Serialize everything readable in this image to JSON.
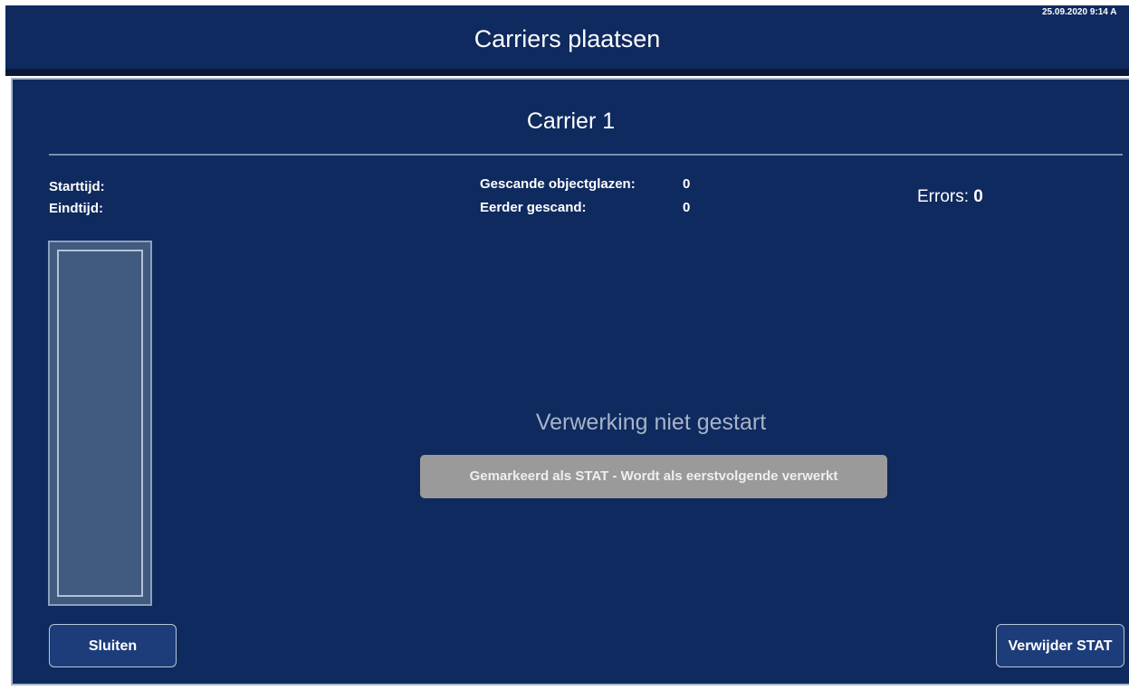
{
  "header": {
    "title": "Carriers plaatsen",
    "datetime": "25.09.2020 9:14 A"
  },
  "panel": {
    "title": "Carrier 1",
    "starttijd_label": "Starttijd:",
    "eindtijd_label": "Eindtijd:",
    "gescande_label": "Gescande objectglazen:",
    "gescande_value": "0",
    "eerder_label": "Eerder gescand:",
    "eerder_value": "0",
    "errors_label": "Errors:",
    "errors_value": "0",
    "status_text": "Verwerking niet gestart",
    "stat_banner": "Gemarkeerd als STAT - Wordt als eerstvolgende verwerkt"
  },
  "buttons": {
    "close_label": "Sluiten",
    "remove_stat_label": "Verwijder STAT"
  },
  "colors": {
    "background": "#0f2a5e",
    "button": "#1c3d7a",
    "banner": "#9a9a9a"
  }
}
